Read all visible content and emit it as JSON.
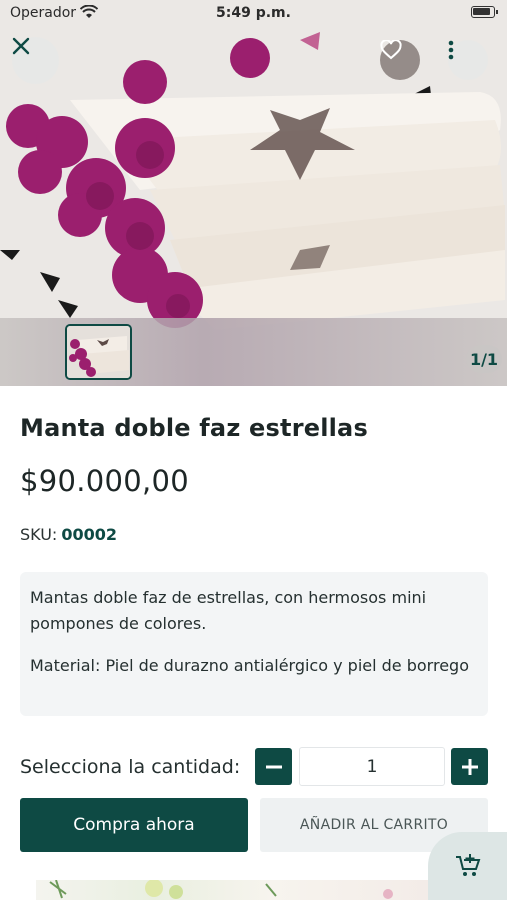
{
  "status_bar": {
    "carrier": "Operador",
    "time": "5:49 p.m."
  },
  "gallery": {
    "counter": "1/1"
  },
  "product": {
    "title": "Manta doble faz estrellas",
    "price": "$90.000,00",
    "sku_label": "SKU:",
    "sku_value": "00002",
    "description": [
      "Mantas doble faz de estrellas, con hermosos mini pompones de colores.",
      "Material: Piel de durazno antialérgico y piel de borrego"
    ]
  },
  "quantity": {
    "label": "Selecciona la cantidad:",
    "value": "1",
    "minus": "−",
    "plus": "+"
  },
  "actions": {
    "buy_now": "Compra ahora",
    "add_to_cart": "AÑADIR AL CARRITO"
  },
  "icons": {
    "close": "close-icon",
    "favorite": "heart-icon",
    "more": "more-vertical-icon",
    "floating_cart": "cart-plus-icon",
    "wifi": "wifi-icon",
    "battery": "battery-icon"
  },
  "colors": {
    "primary": "#0e4a44",
    "secondary_button": "#eef1f2",
    "description_bg": "#f3f5f6",
    "pompom": "#9b1f6e"
  }
}
